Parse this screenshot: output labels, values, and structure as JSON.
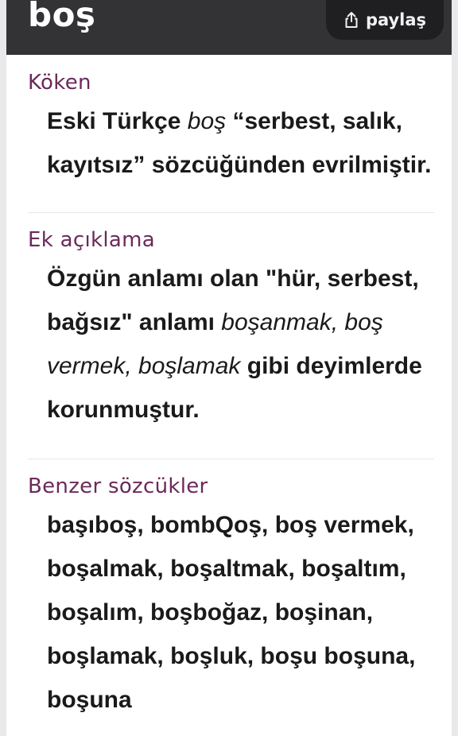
{
  "header": {
    "word": "boş",
    "share_label": "paylaş"
  },
  "sections": {
    "koken": {
      "heading": "Köken",
      "text_1": "Eski Türkçe ",
      "italic_1": "boş",
      "text_2": " “serbest, salık, kayıtsız” sözcüğünden evrilmiştir."
    },
    "ek_aciklama": {
      "heading": "Ek açıklama",
      "text_1": "Özgün anlamı olan \"hür, serbest, bağsız\" anlamı ",
      "italic_1": "boşanmak, boş vermek, boşlamak",
      "text_2": " gibi deyimlerde korunmuştur."
    },
    "benzer": {
      "heading": "Benzer sözcükler",
      "text": "başıboş, bombQoş, boş vermek, boşalmak, boşaltmak, boşaltım, boşalım, boşboğaz, boşinan, boşlamak, boşluk, boşu boşuna, boşuna"
    }
  }
}
